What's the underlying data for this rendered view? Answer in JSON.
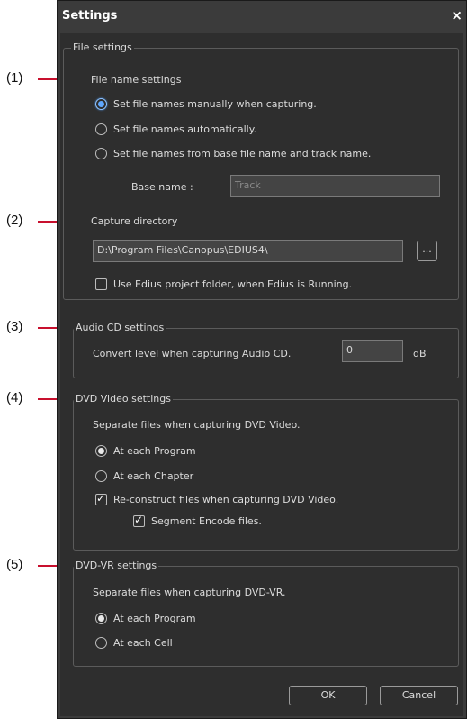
{
  "callouts": [
    "(1)",
    "(2)",
    "(3)",
    "(4)",
    "(5)"
  ],
  "window": {
    "title": "Settings",
    "close_glyph": "×"
  },
  "file_settings": {
    "legend": "File settings",
    "file_name_settings_label": "File name settings",
    "radio_manual": "Set file names manually when capturing.",
    "radio_auto": "Set file names automatically.",
    "radio_base": "Set file names from base file name and track name.",
    "base_name_label": "Base name :",
    "base_name_value": "Track",
    "capture_directory_label": "Capture directory",
    "capture_directory_value": "D:\\Program Files\\Canopus\\EDIUS4\\",
    "browse_label": "...",
    "use_project_folder": "Use Edius project folder, when Edius is Running."
  },
  "audio_cd": {
    "legend": "Audio CD settings",
    "convert_label": "Convert level when capturing Audio CD.",
    "level_value": "0",
    "unit": "dB"
  },
  "dvd_video": {
    "legend": "DVD Video settings",
    "separate_label": "Separate files when capturing DVD Video.",
    "at_each_program": "At each Program",
    "at_each_chapter": "At each Chapter",
    "reconstruct": "Re-construct files when capturing DVD Video.",
    "segment_encode": "Segment Encode files."
  },
  "dvd_vr": {
    "legend": "DVD-VR settings",
    "separate_label": "Separate files when capturing DVD-VR.",
    "at_each_program": "At each Program",
    "at_each_cell": "At each Cell"
  },
  "buttons": {
    "ok": "OK",
    "cancel": "Cancel"
  },
  "colors": {
    "callout_line": "#c8102e",
    "window_bg": "#3b3b3b",
    "client_bg": "#2e2e2e",
    "radio_selected": "#5fa8ff"
  },
  "state": {
    "file_name_mode": "manual",
    "use_project_folder_checked": false,
    "dvd_video_split": "program",
    "reconstruct_checked": true,
    "segment_encode_checked": true,
    "dvd_vr_split": "program"
  }
}
